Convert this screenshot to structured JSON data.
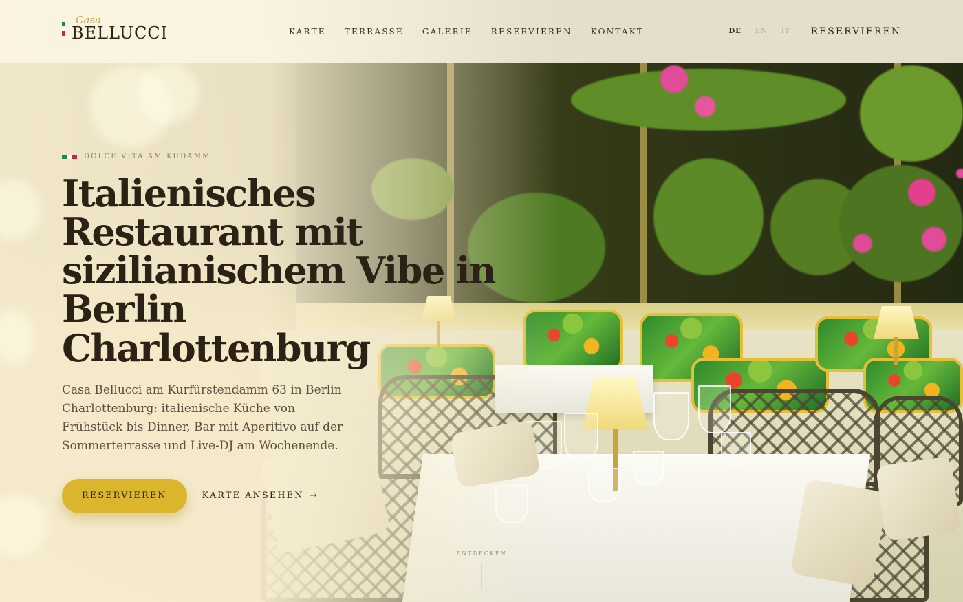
{
  "brand": {
    "script": "Casa",
    "name": "BELLUCCI",
    "flag_colors": [
      "#1f8a3b",
      "#ffffff",
      "#d0283a"
    ]
  },
  "nav": {
    "items": [
      {
        "label": "KARTE"
      },
      {
        "label": "TERRASSE"
      },
      {
        "label": "GALERIE"
      },
      {
        "label": "RESERVIEREN"
      },
      {
        "label": "KONTAKT"
      }
    ]
  },
  "languages": {
    "items": [
      {
        "label": "DE",
        "active": true
      },
      {
        "label": "EN",
        "active": false
      },
      {
        "label": "IT",
        "active": false
      }
    ]
  },
  "header_cta": "RESERVIEREN",
  "hero": {
    "eyebrow": "DOLCE VITA AM KUDAMM",
    "headline": "Italienisches Restaurant mit sizilianischem Vibe in Berlin Charlottenburg",
    "lead": "Casa Bellucci am Kurfürstendamm 63 in Berlin Charlottenburg: italienische Küche von Frühstück bis Dinner, Bar mit Aperitivo auf der Sommerterrasse und Live-DJ am Wochenende.",
    "primary_cta": "RESERVIEREN",
    "secondary_cta": "KARTE ANSEHEN",
    "secondary_arrow": "→"
  },
  "scroll_hint": "ENTDECKEN",
  "colors": {
    "accent": "#dbb62c",
    "text_dark": "#2b2114",
    "cream": "#f5ecd2"
  }
}
